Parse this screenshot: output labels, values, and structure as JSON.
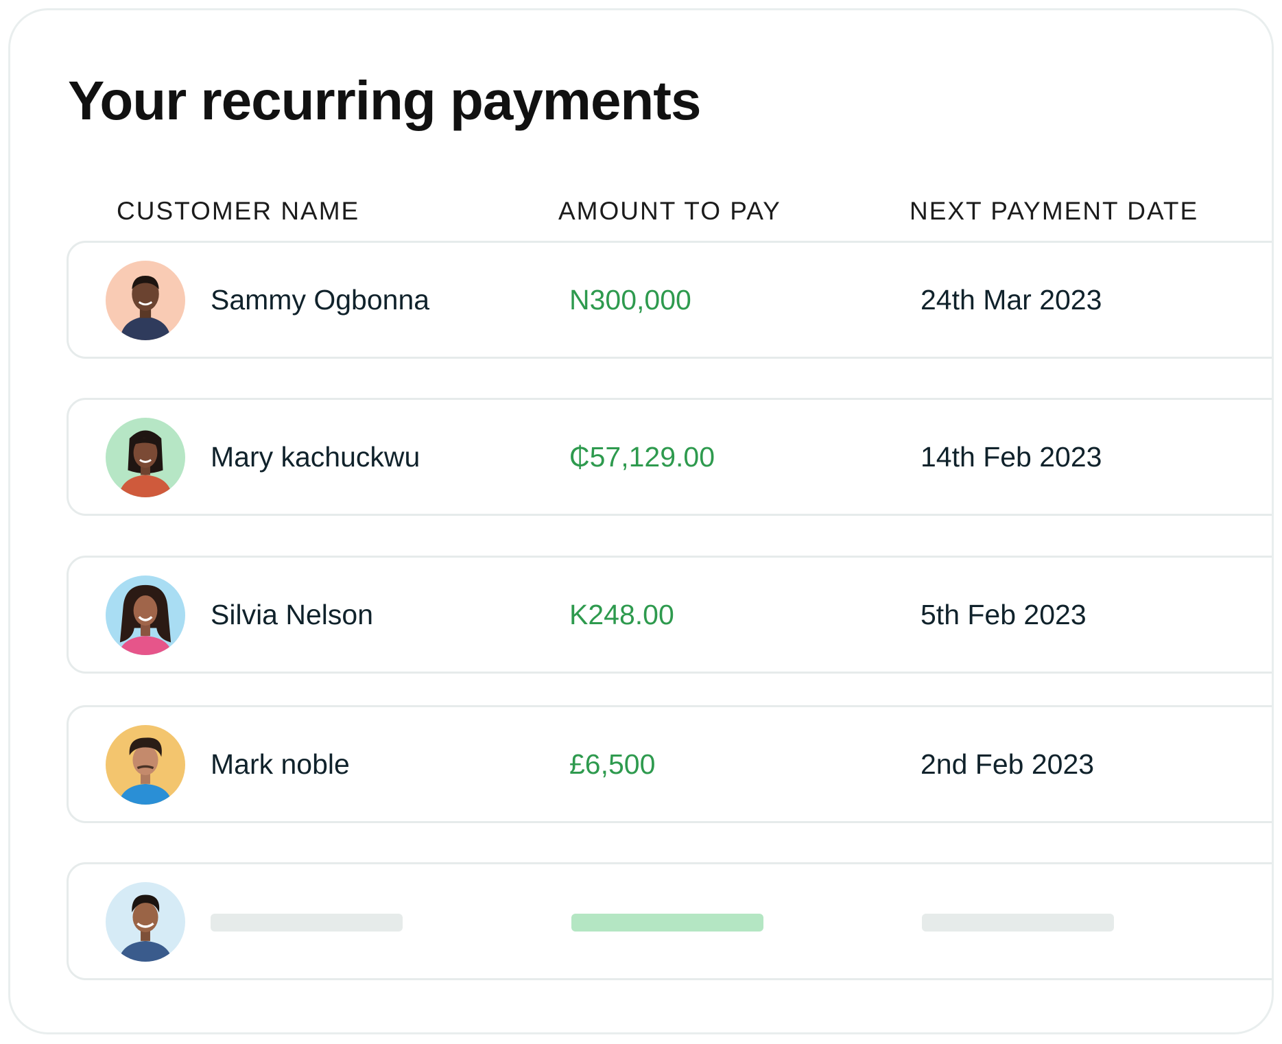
{
  "title": "Your recurring payments",
  "columns": {
    "customer_name": "CUSTOMER NAME",
    "amount_to_pay": "AMOUNT TO PAY",
    "next_payment_date": "NEXT PAYMENT DATE"
  },
  "colors": {
    "amount_green": "#2e9a4e",
    "skeleton_gray": "#e6ebea",
    "skeleton_green": "#b4e6c3"
  },
  "rows": [
    {
      "name": "Sammy Ogbonna",
      "amount": "N300,000",
      "date": "24th Mar 2023",
      "avatar_bg": "#f9cbb4"
    },
    {
      "name": "Mary kachuckwu",
      "amount": "₵57,129.00",
      "date": "14th Feb 2023",
      "avatar_bg": "#b6e6c5"
    },
    {
      "name": "Silvia Nelson",
      "amount": "K248.00",
      "date": "5th Feb 2023",
      "avatar_bg": "#a9ddf3"
    },
    {
      "name": "Mark noble",
      "amount": "£6,500",
      "date": "2nd Feb 2023",
      "avatar_bg": "#f3c56e"
    }
  ],
  "placeholder_row": {
    "avatar_bg": "#d6ebf6",
    "loading": true
  }
}
